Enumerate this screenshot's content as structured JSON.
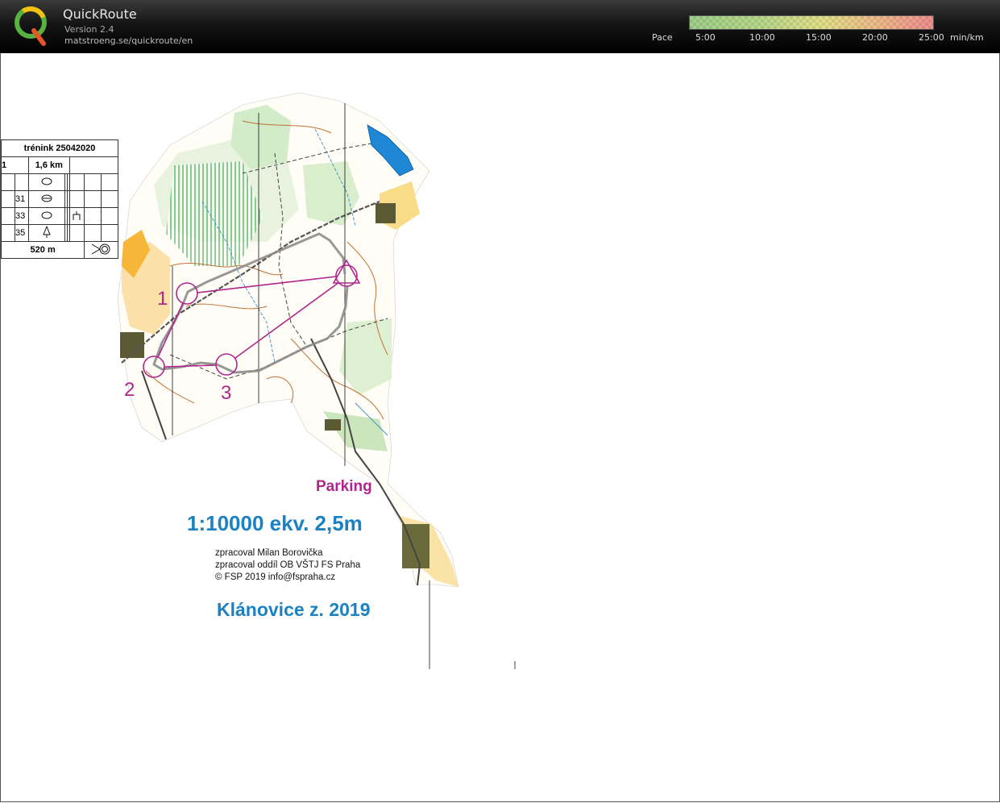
{
  "app": {
    "title": "QuickRoute",
    "version": "Version 2.4",
    "url": "matstroeng.se/quickroute/en"
  },
  "pace": {
    "label": "Pace",
    "ticks": [
      "5:00",
      "10:00",
      "15:00",
      "20:00",
      "25:00"
    ],
    "unit": "min/km"
  },
  "map": {
    "course": {
      "title": "trénink 25042020",
      "number": "1",
      "length": "1,6 km",
      "controls": [
        {
          "code": "",
          "symbol": "ellipse"
        },
        {
          "code": "31",
          "symbol": "ellipse-split"
        },
        {
          "code": "33",
          "symbol": "ellipse"
        },
        {
          "code": "35",
          "symbol": "tree"
        }
      ],
      "finish_distance": "520 m"
    },
    "control_numbers": [
      "1",
      "2",
      "3"
    ],
    "parking_label": "Parking",
    "scale_text": "1:10000 ekv. 2,5m",
    "credit_lines": [
      "zpracoval Milan Borovička",
      "zpracoval oddíl OB VŠTJ FS Praha",
      "© FSP 2019  info@fspraha.cz"
    ],
    "map_name": "Klánovice z. 2019",
    "colors": {
      "overprint": "#b0268e",
      "title_blue": "#1b82c1",
      "route": "#8c8c8c"
    }
  }
}
